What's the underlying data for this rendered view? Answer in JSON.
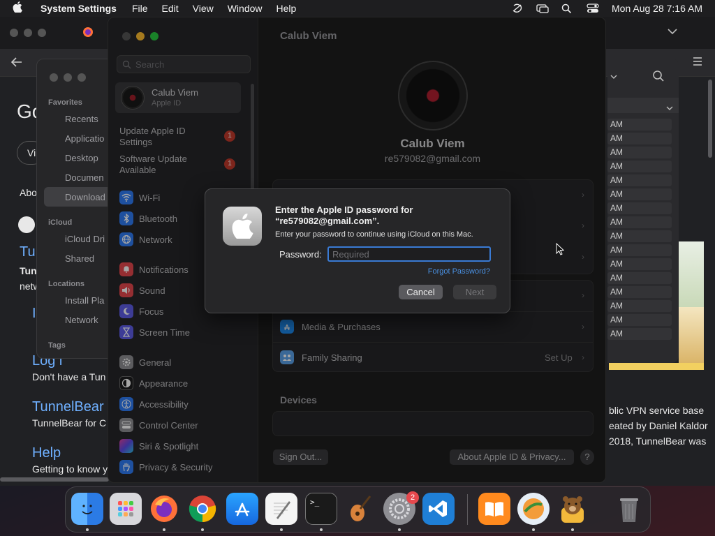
{
  "menubar": {
    "app_name": "System Settings",
    "menus": [
      "File",
      "Edit",
      "View",
      "Window",
      "Help"
    ],
    "datetime": "Mon Aug 28  7:16 AM"
  },
  "browser_page": {
    "heading_partial": "Go",
    "vi_partial": "Vi",
    "about_partial": "Abo",
    "tun_partial": "Tun",
    "tunn_partial": "Tunn",
    "netw_partial": "netw",
    "l_partial": "I",
    "login_partial": "Log i",
    "no_account_partial": "Don't have a Tun",
    "tunnelbear_link": "TunnelBear",
    "tunnelbear_for": "TunnelBear for C",
    "help_link": "Help",
    "getting_to_know": "Getting to know y",
    "right_text_1": "blic VPN service base",
    "right_text_2": "eated by Daniel Kaldor",
    "right_text_3": "2018, TunnelBear was"
  },
  "finder": {
    "favorites_header": "Favorites",
    "favorites": [
      "Recents",
      "Applicatio",
      "Desktop",
      "Documen",
      "Download"
    ],
    "icloud_header": "iCloud",
    "icloud": [
      "iCloud Dri",
      "Shared"
    ],
    "locations_header": "Locations",
    "locations": [
      "Install Pla",
      "Network"
    ],
    "tags_header": "Tags"
  },
  "timelist": {
    "rows": [
      "AM",
      "AM",
      "AM",
      "AM",
      "AM",
      "AM",
      "AM",
      "AM",
      "AM",
      "AM",
      "AM",
      "AM",
      "AM",
      "AM",
      "AM",
      "AM"
    ]
  },
  "settings": {
    "search_placeholder": "Search",
    "account": {
      "name": "Calub Viem",
      "subtitle": "Apple ID"
    },
    "notices": [
      {
        "label": "Update Apple ID Settings",
        "badge": "1"
      },
      {
        "label": "Software Update Available",
        "badge": "1"
      }
    ],
    "items": [
      {
        "label": "Wi-Fi",
        "icon": "wifi-icon",
        "color": "#2f7bf5"
      },
      {
        "label": "Bluetooth",
        "icon": "bluetooth-icon",
        "color": "#2f7bf5"
      },
      {
        "label": "Network",
        "icon": "globe-icon",
        "color": "#2f7bf5"
      },
      {
        "label": "Notifications",
        "icon": "bell-icon",
        "color": "#e5484d"
      },
      {
        "label": "Sound",
        "icon": "speaker-icon",
        "color": "#e5484d"
      },
      {
        "label": "Focus",
        "icon": "moon-icon",
        "color": "#5e5ce6"
      },
      {
        "label": "Screen Time",
        "icon": "hourglass-icon",
        "color": "#5e5ce6"
      },
      {
        "label": "General",
        "icon": "gear-icon",
        "color": "#8e8e93"
      },
      {
        "label": "Appearance",
        "icon": "appearance-icon",
        "color": "#1c1c1e"
      },
      {
        "label": "Accessibility",
        "icon": "accessibility-icon",
        "color": "#2f7bf5"
      },
      {
        "label": "Control Center",
        "icon": "control-center-icon",
        "color": "#8e8e93"
      },
      {
        "label": "Siri & Spotlight",
        "icon": "siri-icon",
        "color": "#b04cd6"
      },
      {
        "label": "Privacy & Security",
        "icon": "hand-icon",
        "color": "#2f7bf5"
      }
    ],
    "header_title": "Calub Viem",
    "profile_name": "Calub Viem",
    "profile_email": "re579082@gmail.com",
    "rows": [
      {
        "label": "Media & Purchases",
        "value": ""
      },
      {
        "label": "Family Sharing",
        "value": "Set Up"
      }
    ],
    "devices_header": "Devices",
    "sign_out": "Sign Out...",
    "about_privacy": "About Apple ID & Privacy...",
    "help": "?"
  },
  "dialog": {
    "title": "Enter the Apple ID password for “re579082@gmail.com”.",
    "message": "Enter your password to continue using iCloud on this Mac.",
    "password_label": "Password:",
    "password_placeholder": "Required",
    "forgot": "Forgot Password?",
    "cancel": "Cancel",
    "next": "Next"
  },
  "dock": {
    "apps": [
      {
        "name": "finder-icon",
        "color": "#3d8df5"
      },
      {
        "name": "launchpad-icon",
        "color": "#d8d8dc"
      },
      {
        "name": "firefox-icon",
        "color": "#ff7139"
      },
      {
        "name": "chrome-icon",
        "color": "#f2f2f2"
      },
      {
        "name": "app-store-icon",
        "color": "#1e8ff7"
      },
      {
        "name": "textedit-icon",
        "color": "#f4f4f4"
      },
      {
        "name": "terminal-icon",
        "color": "#1a1a1a"
      },
      {
        "name": "garageband-icon",
        "color": "#e07a2a"
      },
      {
        "name": "system-settings-icon",
        "color": "#8e8e93"
      },
      {
        "name": "vscode-icon",
        "color": "#1f7fd6"
      },
      {
        "name": "books-icon",
        "color": "#ff8a1e"
      },
      {
        "name": "safari-like-icon",
        "color": "#e6eef6"
      },
      {
        "name": "tunnelbear-icon",
        "color": "#f2b93b"
      },
      {
        "name": "trash-icon",
        "color": "#6f6f73"
      }
    ],
    "settings_badge": "2",
    "terminal_prompt": ">_"
  }
}
